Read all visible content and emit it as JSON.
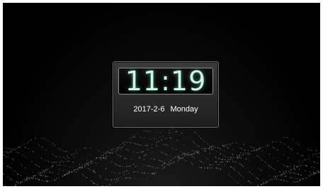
{
  "clock": {
    "time": "11:19",
    "date": "2017-2-6",
    "weekday": "Monday"
  },
  "colors": {
    "background": "#000000",
    "digit_glow": "#c9f7e3",
    "widget_border": "#6a6a6a"
  }
}
